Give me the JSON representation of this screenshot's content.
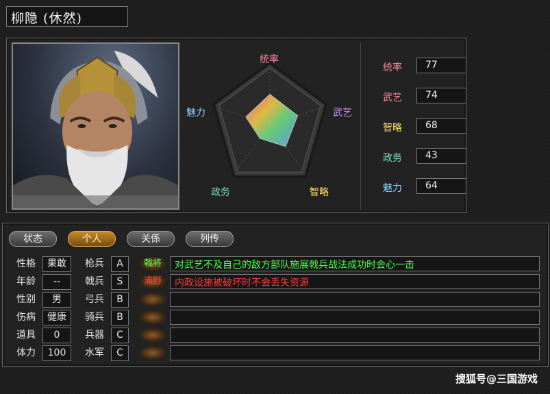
{
  "general": {
    "name": "柳隐 (休然)"
  },
  "radar": {
    "labels": {
      "command": "统率",
      "war": "武艺",
      "intel": "智略",
      "politics": "政务",
      "charm": "魅力"
    },
    "max": 100,
    "values": {
      "command": 77,
      "war": 74,
      "intel": 68,
      "politics": 43,
      "charm": 64
    }
  },
  "stats": [
    {
      "label": "统率",
      "value": "77",
      "color": "#ff8ba0"
    },
    {
      "label": "武艺",
      "value": "74",
      "color": "#ff8ba0"
    },
    {
      "label": "智略",
      "value": "68",
      "color": "#ffe066"
    },
    {
      "label": "政务",
      "value": "43",
      "color": "#7ee0c0"
    },
    {
      "label": "魅力",
      "value": "64",
      "color": "#8fd0ff"
    }
  ],
  "tabs": [
    {
      "label": "状态",
      "active": false
    },
    {
      "label": "个人",
      "active": true
    },
    {
      "label": "关係",
      "active": false
    },
    {
      "label": "列传",
      "active": false
    }
  ],
  "personal": [
    {
      "label": "性格",
      "value": "果敢"
    },
    {
      "label": "年龄",
      "value": "--"
    },
    {
      "label": "性别",
      "value": "男"
    },
    {
      "label": "伤病",
      "value": "健康"
    },
    {
      "label": "道具",
      "value": "0"
    },
    {
      "label": "体力",
      "value": "100"
    }
  ],
  "aptitude": [
    {
      "label": "枪兵",
      "value": "A"
    },
    {
      "label": "戟兵",
      "value": "S"
    },
    {
      "label": "弓兵",
      "value": "B"
    },
    {
      "label": "骑兵",
      "value": "B"
    },
    {
      "label": "兵器",
      "value": "C"
    },
    {
      "label": "水军",
      "value": "C"
    }
  ],
  "skills": [
    {
      "name": "戟将",
      "desc": "对武艺不及自己的敌方部队施展戟兵战法成功时会心一击",
      "color": "#4cff4c"
    },
    {
      "name": "清野",
      "desc": "内政设施被破坏时不会丢失资源",
      "color": "#ff3b3b"
    },
    {
      "name": "",
      "desc": "",
      "color": "#ffffff"
    },
    {
      "name": "",
      "desc": "",
      "color": "#ffffff"
    },
    {
      "name": "",
      "desc": "",
      "color": "#ffffff"
    },
    {
      "name": "",
      "desc": "",
      "color": "#ffffff"
    }
  ],
  "watermark": "搜狐号@三国游戏"
}
